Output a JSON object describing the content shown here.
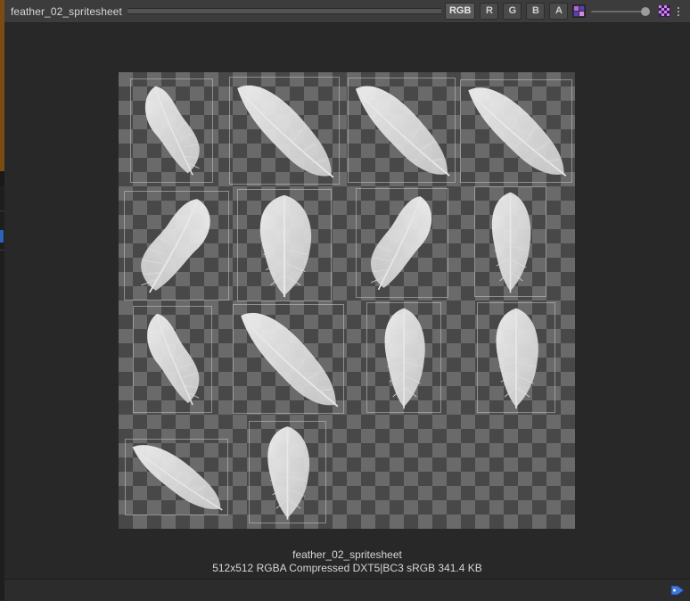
{
  "header": {
    "title": "feather_02_spritesheet",
    "channels": [
      {
        "label": "RGB",
        "active": true
      },
      {
        "label": "R",
        "active": false
      },
      {
        "label": "G",
        "active": false
      },
      {
        "label": "B",
        "active": false
      },
      {
        "label": "A",
        "active": false
      }
    ],
    "mip_icon": "mipmap-icon",
    "mip_level": 1.0,
    "alpha_icon": "alpha-checker-icon",
    "menu_icon": "more-vertical-icon"
  },
  "preview": {
    "sprite_count": 14
  },
  "info": {
    "name": "feather_02_spritesheet",
    "meta": "512x512  RGBA Compressed DXT5|BC3 sRGB   341.4 KB"
  },
  "status_bar": {
    "tag_icon": "asset-label-icon"
  },
  "colors": {
    "background": "#282828",
    "header": "#3c3c3c",
    "accent_blue": "#2a63b8",
    "checker_light": "#6a6a6a",
    "checker_dark": "#484848"
  }
}
